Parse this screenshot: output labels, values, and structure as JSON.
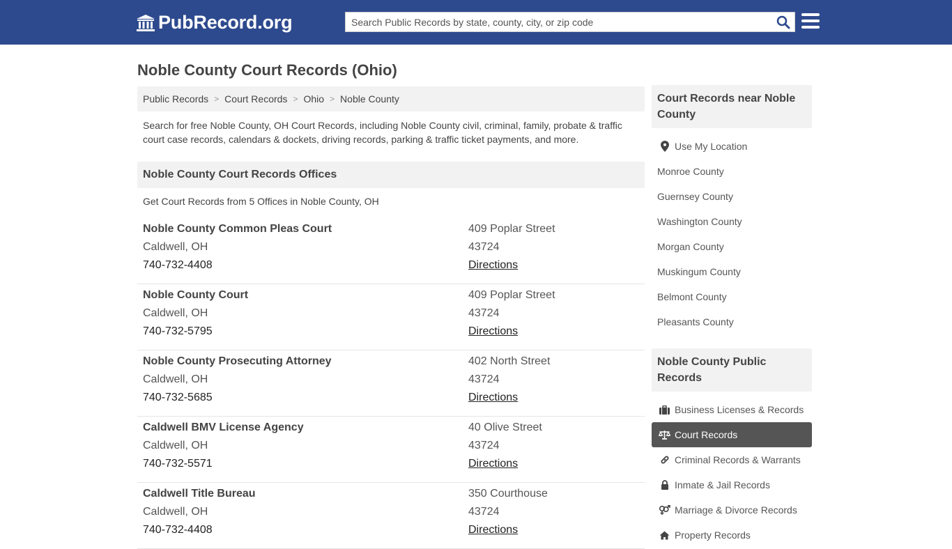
{
  "header": {
    "logo_text": "PubRecord.org",
    "search_placeholder": "Search Public Records by state, county, city, or zip code",
    "brand_color": "#2e4a8e"
  },
  "page_title": "Noble County Court Records (Ohio)",
  "breadcrumb": [
    "Public Records",
    "Court Records",
    "Ohio",
    "Noble County"
  ],
  "intro": "Search for free Noble County, OH Court Records, including Noble County civil, criminal, family, probate & traffic court case records, calendars & dockets, driving records, parking & traffic ticket payments, and more.",
  "offices_section": {
    "heading": "Noble County Court Records Offices",
    "subtext": "Get Court Records from 5 Offices in Noble County, OH",
    "offices": [
      {
        "name": "Noble County Common Pleas Court",
        "city": "Caldwell, OH",
        "phone": "740-732-4408",
        "street": "409 Poplar Street",
        "zip": "43724",
        "directions": "Directions"
      },
      {
        "name": "Noble County Court",
        "city": "Caldwell, OH",
        "phone": "740-732-5795",
        "street": "409 Poplar Street",
        "zip": "43724",
        "directions": "Directions"
      },
      {
        "name": "Noble County Prosecuting Attorney",
        "city": "Caldwell, OH",
        "phone": "740-732-5685",
        "street": "402 North Street",
        "zip": "43724",
        "directions": "Directions"
      },
      {
        "name": "Caldwell BMV License Agency",
        "city": "Caldwell, OH",
        "phone": "740-732-5571",
        "street": "40 Olive Street",
        "zip": "43724",
        "directions": "Directions"
      },
      {
        "name": "Caldwell Title Bureau",
        "city": "Caldwell, OH",
        "phone": "740-732-4408",
        "street": "350 Courthouse",
        "zip": "43724",
        "directions": "Directions"
      }
    ]
  },
  "sidebar": {
    "nearby": {
      "heading": "Court Records near Noble County",
      "use_location": "Use My Location",
      "items": [
        "Monroe County",
        "Guernsey County",
        "Washington County",
        "Morgan County",
        "Muskingum County",
        "Belmont County",
        "Pleasants County"
      ]
    },
    "public_records": {
      "heading": "Noble County Public Records",
      "items": [
        {
          "label": "Business Licenses & Records",
          "icon": "briefcase-icon",
          "active": false
        },
        {
          "label": "Court Records",
          "icon": "scales-icon",
          "active": true
        },
        {
          "label": "Criminal Records & Warrants",
          "icon": "link-icon",
          "active": false
        },
        {
          "label": "Inmate & Jail Records",
          "icon": "lock-icon",
          "active": false
        },
        {
          "label": "Marriage & Divorce Records",
          "icon": "gender-icon",
          "active": false
        },
        {
          "label": "Property Records",
          "icon": "home-icon",
          "active": false
        }
      ]
    }
  }
}
